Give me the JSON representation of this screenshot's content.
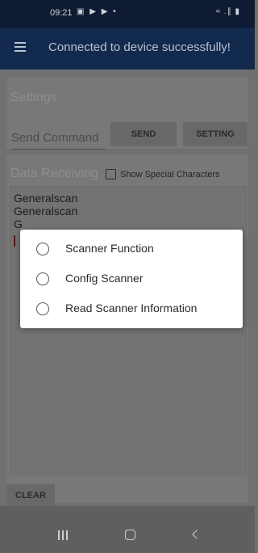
{
  "status_bar": {
    "time": "09:21",
    "notification_icons": "▣ ▶ ▶ •",
    "system_icons": "≈ .∥ ▮"
  },
  "app_bar": {
    "title": "Connected to device successfully!",
    "menu_icon": "hamburger-menu-icon"
  },
  "settings": {
    "title": "Settings",
    "command_placeholder": "Send Command",
    "send_label": "SEND",
    "setting_label": "SETTING"
  },
  "data_receiving": {
    "title": "Data Receiving",
    "show_special_label": "Show Special Characters",
    "show_special_checked": false,
    "lines": [
      "Generalscan",
      "Generalscan",
      "G"
    ],
    "clear_label": "CLEAR"
  },
  "dialog": {
    "options": [
      {
        "label": "Scanner Function",
        "selected": false
      },
      {
        "label": "Config Scanner",
        "selected": false
      },
      {
        "label": "Read Scanner Information",
        "selected": false
      }
    ]
  },
  "nav_bar": {
    "recent_icon": "recent-apps-icon",
    "home_icon": "home-icon",
    "back_icon": "back-icon"
  },
  "colors": {
    "status_bar": "#0f1a33",
    "app_bar": "#122a4e",
    "scrim_content": "#707070",
    "dialog_bg": "#ffffff"
  }
}
